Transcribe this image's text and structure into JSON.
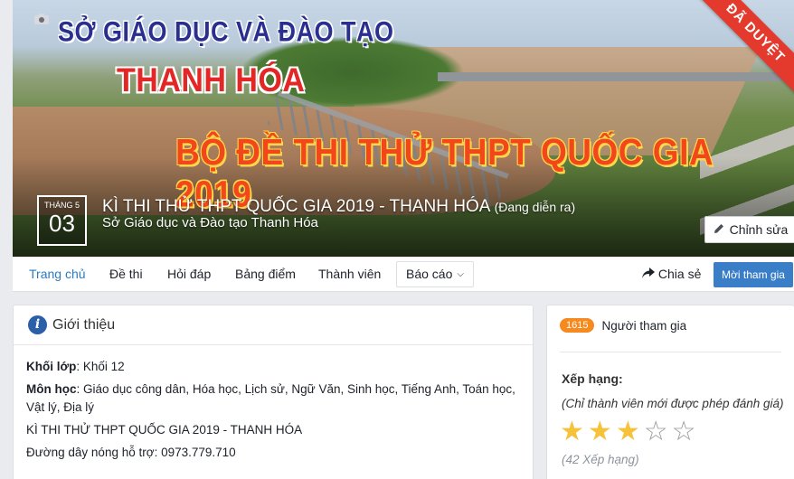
{
  "cover": {
    "banner_line1": "SỞ GIÁO DỤC VÀ ĐÀO TẠO",
    "banner_line2": "THANH HÓA",
    "banner_line3": "BỘ ĐỀ THI THỬ THPT QUỐC GIA 2019",
    "approved_ribbon": "ĐÃ DUYỆT",
    "date_month_label": "THÁNG 5",
    "date_day": "03",
    "event_title": "KÌ THI THỬ THPT QUỐC GIA 2019 - THANH HÓA",
    "event_status": "(Đang diễn ra)",
    "organizer": "Sở Giáo dục và Đào tạo Thanh Hóa",
    "edit_label": "Chỉnh sửa"
  },
  "nav": {
    "items": [
      "Trang chủ",
      "Đề thi",
      "Hỏi đáp",
      "Bảng điểm",
      "Thành viên"
    ],
    "dropdown_label": "Báo cáo",
    "share_label": "Chia sẻ",
    "join_label": "Mời tham gia"
  },
  "intro": {
    "heading": "Giới thiệu",
    "grade_label": "Khối lớp",
    "grade_value": ": Khối 12",
    "subjects_label": "Môn học",
    "subjects_value": ": Giáo dục công dân, Hóa học, Lịch sử, Ngữ Văn, Sinh học, Tiếng Anh, Toán học, Vật lý, Địa lý",
    "exam_name": "KÌ THI THỬ THPT QUỐC GIA 2019 - THANH HÓA",
    "hotline": "Đường dây nóng hỗ trợ: 0973.779.710"
  },
  "side": {
    "participant_count": "1615",
    "participant_label": "Người tham gia",
    "rating_label": "Xếp hạng:",
    "rating_note": "(Chỉ thành viên mới được phép đánh giá)",
    "rating_stars": 3,
    "rating_max": 5,
    "rating_count_text": "(42 Xếp hạng)"
  },
  "colors": {
    "accent": "#2b7bc0",
    "join_button": "#3b7ec8",
    "ribbon": "#e43a2d",
    "badge": "#f68a1e",
    "star_on": "#f5c23a"
  }
}
